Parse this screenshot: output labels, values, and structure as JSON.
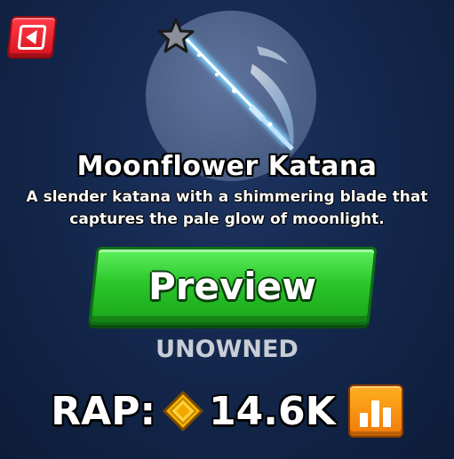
{
  "item": {
    "name": "Moonflower Katana",
    "description": "A slender katana with a shimmering blade that captures the pale glow of moonlight.",
    "status": "UNOWNED"
  },
  "actions": {
    "preview_label": "Preview"
  },
  "rap": {
    "label": "RAP:",
    "value": "14.6K"
  },
  "icons": {
    "back": "back-arrow-icon",
    "favorite": "star-icon",
    "currency": "diamond-coin-icon",
    "stats": "bar-chart-icon"
  },
  "colors": {
    "back_button": "#e8202b",
    "preview_button": "#2cc72c",
    "stats_button": "#f59512",
    "status_text": "#c8cdd6"
  }
}
